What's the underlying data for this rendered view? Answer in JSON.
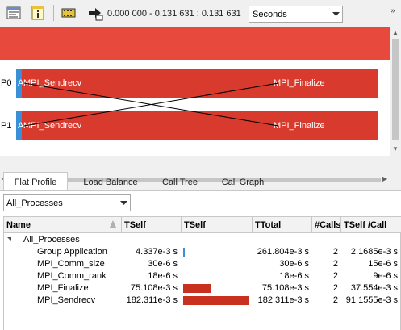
{
  "toolbar": {
    "range_text": "0.000 000 - 0.131 631 : 0.131 631",
    "unit_selected": "Seconds",
    "icons": [
      "timeline-legend-icon",
      "info-icon",
      "film-icon",
      "export-icon"
    ]
  },
  "timeline": {
    "summary_color": "#e8493d",
    "processes": [
      {
        "label": "P0",
        "first_fn": "A",
        "fn_left": "MPI_Sendrecv",
        "fn_right": "MPI_Finalize"
      },
      {
        "label": "P1",
        "first_fn": "A",
        "fn_left": "MPI_Sendrecv",
        "fn_right": "MPI_Finalize"
      }
    ],
    "colors": {
      "strip": "#3b8fd6",
      "bar": "#d93a2e"
    }
  },
  "tabs": [
    {
      "label": "Flat Profile",
      "active": true
    },
    {
      "label": "Load Balance",
      "active": false
    },
    {
      "label": "Call Tree",
      "active": false
    },
    {
      "label": "Call Graph",
      "active": false
    }
  ],
  "process_filter": {
    "selected": "All_Processes"
  },
  "table": {
    "columns": [
      "Name",
      "TSelf",
      "TSelf",
      "TTotal",
      "#Calls",
      "TSelf /Call"
    ],
    "group_row": {
      "name": "All_Processes"
    },
    "rows": [
      {
        "name": "Group Application",
        "tself": "4.337e-3 s",
        "bar_fraction": 0.0238,
        "ttotal": "261.804e-3 s",
        "calls": "2",
        "tself_call": "2.1685e-3 s"
      },
      {
        "name": "MPI_Comm_size",
        "tself": "30e-6 s",
        "bar_fraction": 0.0,
        "ttotal": "30e-6 s",
        "calls": "2",
        "tself_call": "15e-6 s"
      },
      {
        "name": "MPI_Comm_rank",
        "tself": "18e-6 s",
        "bar_fraction": 0.0,
        "ttotal": "18e-6 s",
        "calls": "2",
        "tself_call": "9e-6 s"
      },
      {
        "name": "MPI_Finalize",
        "tself": "75.108e-3 s",
        "bar_fraction": 0.412,
        "ttotal": "75.108e-3 s",
        "calls": "2",
        "tself_call": "37.554e-3 s"
      },
      {
        "name": "MPI_Sendrecv",
        "tself": "182.311e-3 s",
        "bar_fraction": 1.0,
        "ttotal": "182.311e-3 s",
        "calls": "2",
        "tself_call": "91.1555e-3 s"
      }
    ]
  }
}
